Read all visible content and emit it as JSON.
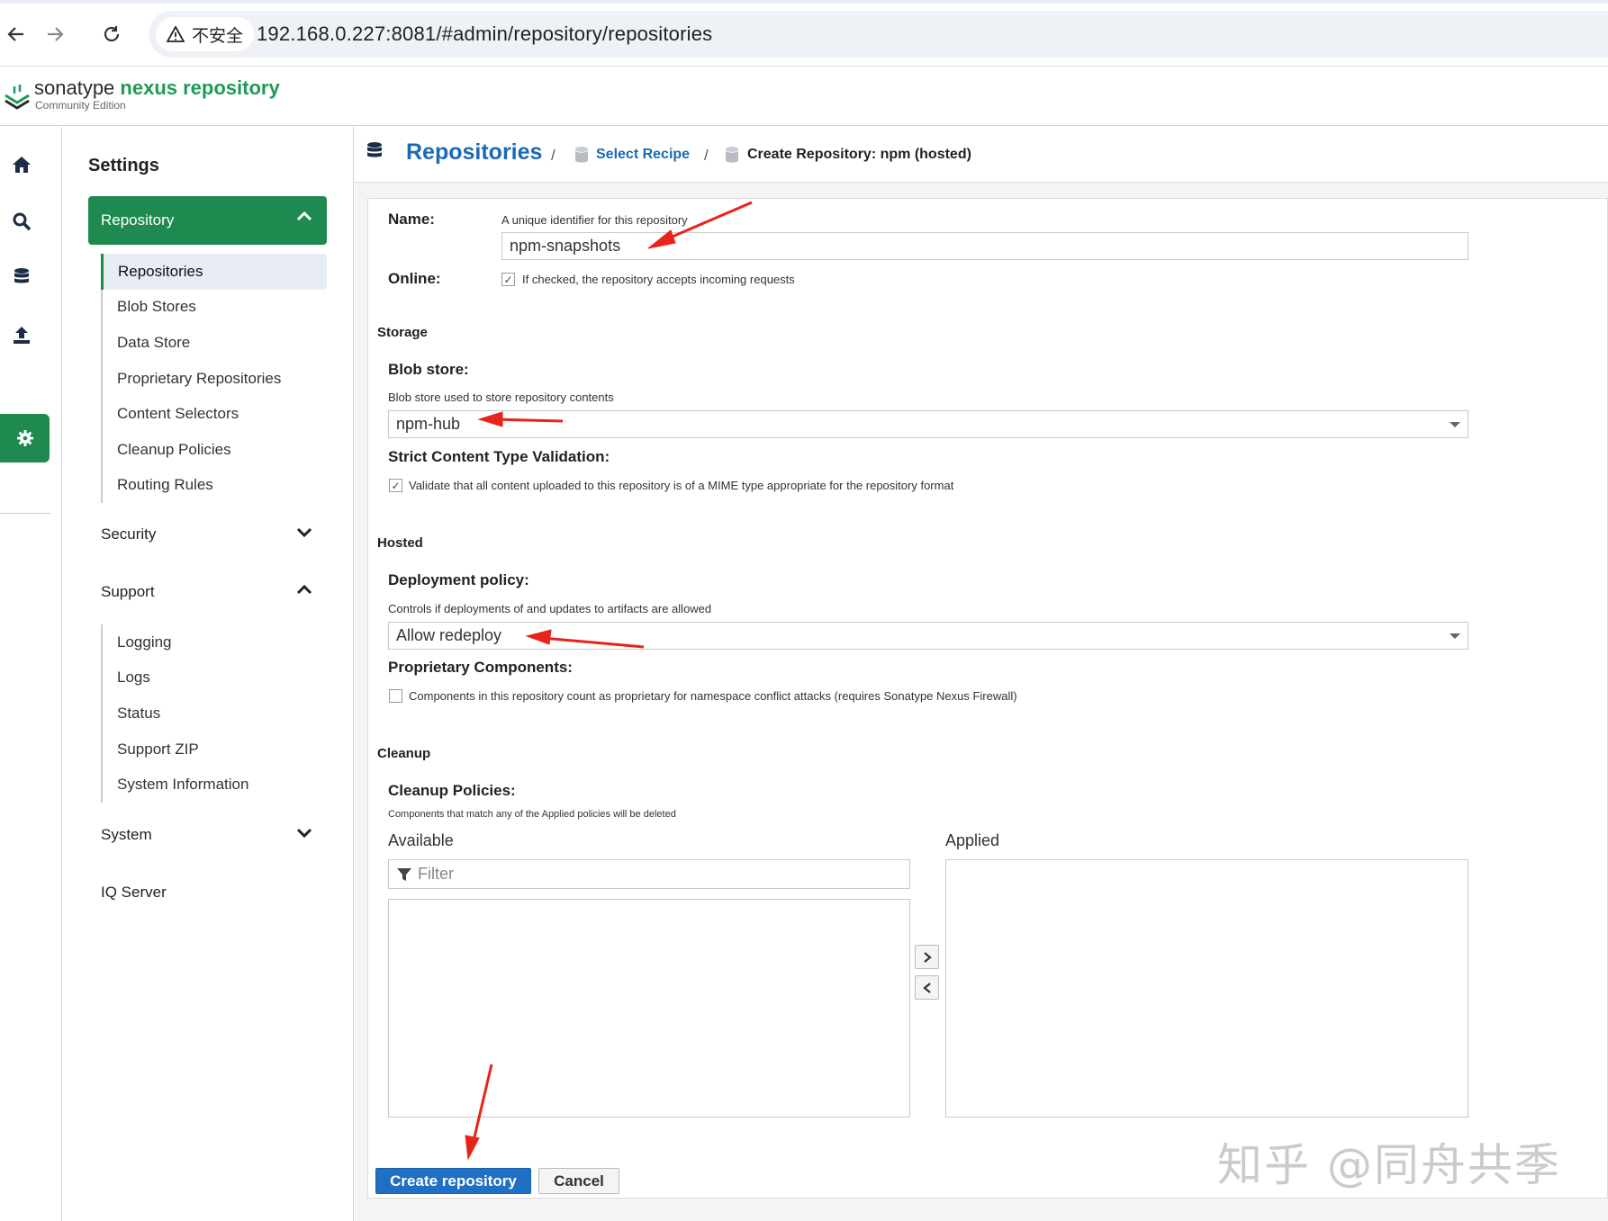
{
  "browser": {
    "security_label": "不安全",
    "url": "192.168.0.227:8081/#admin/repository/repositories"
  },
  "app": {
    "brand_plain": "sonatype",
    "brand_accent": "nexus repository",
    "edition": "Community Edition"
  },
  "sidebar": {
    "title": "Settings",
    "repository_group": "Repository",
    "repository_items": [
      "Repositories",
      "Blob Stores",
      "Data Store",
      "Proprietary Repositories",
      "Content Selectors",
      "Cleanup Policies",
      "Routing Rules"
    ],
    "security_group": "Security",
    "support_group": "Support",
    "support_items": [
      "Logging",
      "Logs",
      "Status",
      "Support ZIP",
      "System Information"
    ],
    "system_group": "System",
    "iq_group": "IQ Server"
  },
  "breadcrumb": {
    "root": "Repositories",
    "sep": "/",
    "recipe": "Select Recipe",
    "current": "Create Repository: npm (hosted)"
  },
  "form": {
    "name_label": "Name:",
    "name_help": "A unique identifier for this repository",
    "name_value": "npm-snapshots",
    "online_label": "Online:",
    "online_help": "If checked, the repository accepts incoming requests",
    "online_checked": true,
    "storage_section": "Storage",
    "blob_label": "Blob store:",
    "blob_help": "Blob store used to store repository contents",
    "blob_value": "npm-hub",
    "strict_label": "Strict Content Type Validation:",
    "strict_help": "Validate that all content uploaded to this repository is of a MIME type appropriate for the repository format",
    "strict_checked": true,
    "hosted_section": "Hosted",
    "deploy_label": "Deployment policy:",
    "deploy_help": "Controls if deployments of and updates to artifacts are allowed",
    "deploy_value": "Allow redeploy",
    "proprietary_label": "Proprietary Components:",
    "proprietary_help": "Components in this repository count as proprietary for namespace conflict attacks (requires Sonatype Nexus Firewall)",
    "proprietary_checked": false,
    "cleanup_section": "Cleanup",
    "cleanup_label": "Cleanup Policies:",
    "cleanup_help": "Components that match any of the Applied policies will be deleted",
    "available_label": "Available",
    "applied_label": "Applied",
    "filter_placeholder": "Filter"
  },
  "actions": {
    "create": "Create repository",
    "cancel": "Cancel"
  },
  "watermark": "知乎 @同舟共季",
  "colors": {
    "brand_green": "#1f8a4f",
    "link_blue": "#1a6ab5",
    "primary_button": "#1f6fc5",
    "annotation_arrow": "#e8231a"
  }
}
